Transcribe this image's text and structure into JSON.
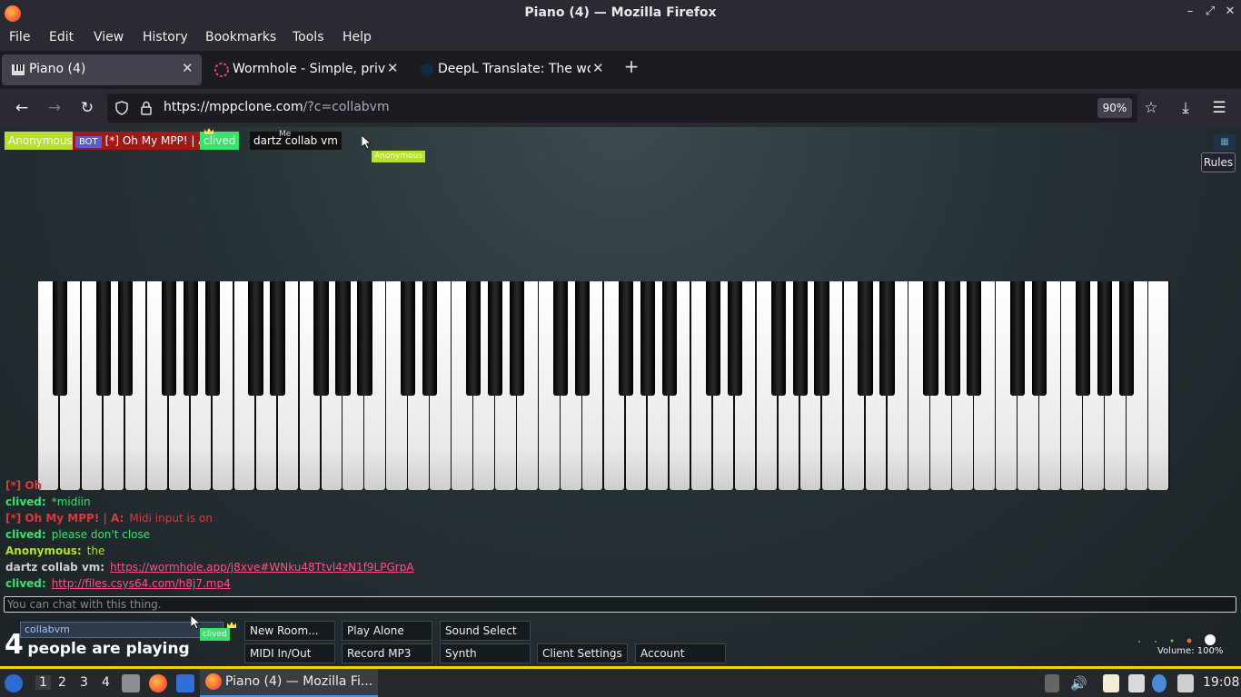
{
  "window": {
    "title": "Piano (4) — Mozilla Firefox",
    "minimize": "–",
    "maximize": "⤢",
    "close": "✕"
  },
  "menu": [
    "File",
    "Edit",
    "View",
    "History",
    "Bookmarks",
    "Tools",
    "Help"
  ],
  "tabs": [
    {
      "label": "Piano (4)",
      "icon": "piano-icon",
      "active": true,
      "close": "✕"
    },
    {
      "label": "Wormhole - Simple, priva",
      "icon": "wormhole-icon",
      "active": false,
      "close": "✕"
    },
    {
      "label": "DeepL Translate: The wor",
      "icon": "deepl-icon",
      "active": false,
      "close": "✕"
    }
  ],
  "newtab": "+",
  "nav": {
    "back": "←",
    "forward": "→",
    "reload": "↻",
    "url_host": "https://mppclone.com",
    "url_rest": "/?c=collabvm",
    "zoom": "90%",
    "bookmark": "☆",
    "downloads": "⤓",
    "menu": "☰"
  },
  "participants": {
    "anonymous": "Anonymous",
    "bot_badge": "BOT",
    "bot_name": "[*] Oh My MPP! | A",
    "clived": "clived",
    "dartz": "dartz collab vm",
    "me": "Me",
    "cursor_label": "Anonymous"
  },
  "rules": "Rules",
  "chat": [
    {
      "who": "[*] Oh",
      "msg": "",
      "who_color": "#d63c3c",
      "msg_color": "#d63c3c"
    },
    {
      "who": "clived:",
      "msg": "*midiin",
      "who_color": "#39e26b",
      "msg_color": "#39e26b"
    },
    {
      "who": "[*] Oh My MPP! | A:",
      "msg": "Midi input is on",
      "who_color": "#d63c3c",
      "msg_color": "#d63c3c"
    },
    {
      "who": "clived:",
      "msg": "please don't close",
      "who_color": "#39e26b",
      "msg_color": "#39e26b"
    },
    {
      "who": "Anonymous:",
      "msg": "the",
      "who_color": "#b6e02a",
      "msg_color": "#b6e02a"
    },
    {
      "who": "dartz collab vm:",
      "msg": "https://wormhole.app/j8xve#WNku48Ttvl4zN1f9LPGrpA",
      "who_color": "#cfcfcf",
      "msg_color": "#ff4f84",
      "link": true
    },
    {
      "who": "clived:",
      "msg": "http://files.csys64.com/h8j7.mp4",
      "who_color": "#39e26b",
      "msg_color": "#ff4f84",
      "link": true
    }
  ],
  "chat_placeholder": "You can chat with this thing.",
  "room": "collabvm",
  "room_owner": "clived",
  "players": {
    "count": "4",
    "text": "people are playing"
  },
  "buttons": {
    "new_room": "New Room...",
    "play_alone": "Play Alone",
    "sound_select": "Sound Select",
    "midi": "MIDI In/Out",
    "record": "Record MP3",
    "synth": "Synth",
    "client_settings": "Client Settings",
    "account": "Account"
  },
  "volume": "Volume: 100%",
  "taskbar": {
    "workspaces": [
      "1",
      "2",
      "3",
      "4"
    ],
    "app_label": "Piano (4) — Mozilla Fi...",
    "clock": "19:08"
  },
  "colors": {
    "anonymous": "#b6e02a",
    "clived": "#39e26b",
    "bot": "#d63c3c",
    "link": "#ff4f84"
  }
}
